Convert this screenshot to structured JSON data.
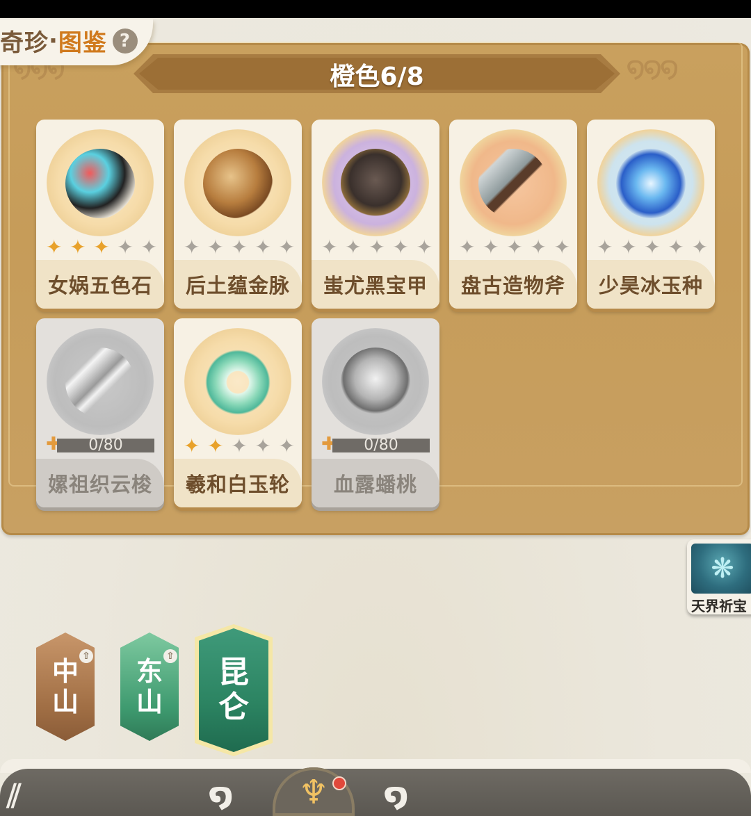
{
  "header": {
    "title_left": "奇珍",
    "title_dot": "·",
    "title_right": "图鉴",
    "help_icon": "question-circle-icon"
  },
  "panel": {
    "banner_title": "橙色6/8"
  },
  "items": [
    {
      "name": "女娲五色石",
      "stars_lit": 3,
      "stars_total": 5,
      "locked": false
    },
    {
      "name": "后土蕴金脉",
      "stars_lit": 0,
      "stars_total": 5,
      "locked": false
    },
    {
      "name": "蚩尤黑宝甲",
      "stars_lit": 0,
      "stars_total": 5,
      "locked": false
    },
    {
      "name": "盘古造物斧",
      "stars_lit": 0,
      "stars_total": 5,
      "locked": false
    },
    {
      "name": "少昊冰玉种",
      "stars_lit": 0,
      "stars_total": 5,
      "locked": false
    },
    {
      "name": "嫘祖织云梭",
      "locked": true,
      "progress": "0/80"
    },
    {
      "name": "羲和白玉轮",
      "stars_lit": 2,
      "stars_total": 5,
      "locked": false
    },
    {
      "name": "血露蟠桃",
      "locked": true,
      "progress": "0/80"
    }
  ],
  "side_button": {
    "label": "天界祈宝",
    "icon": "tree-of-life-icon"
  },
  "regions": [
    {
      "label_top": "中",
      "label_bottom": "山",
      "selected": false,
      "color": "#a06e44"
    },
    {
      "label_top": "东",
      "label_bottom": "山",
      "selected": false,
      "color": "#3e9a6f"
    },
    {
      "label_top": "昆",
      "label_bottom": "仑",
      "selected": true,
      "color": "#2c8462"
    }
  ],
  "colors": {
    "panel": "#c69c59",
    "accent_orange": "#d07a1e",
    "star_lit": "#e8a12a",
    "star_off": "#a8a39b",
    "notify_red": "#e1483a"
  },
  "bottom_nav": {
    "icons": [
      "nav-left-icon",
      "nav-swirl-icon",
      "nav-home-lotus-icon",
      "nav-swirl-icon-2"
    ]
  }
}
